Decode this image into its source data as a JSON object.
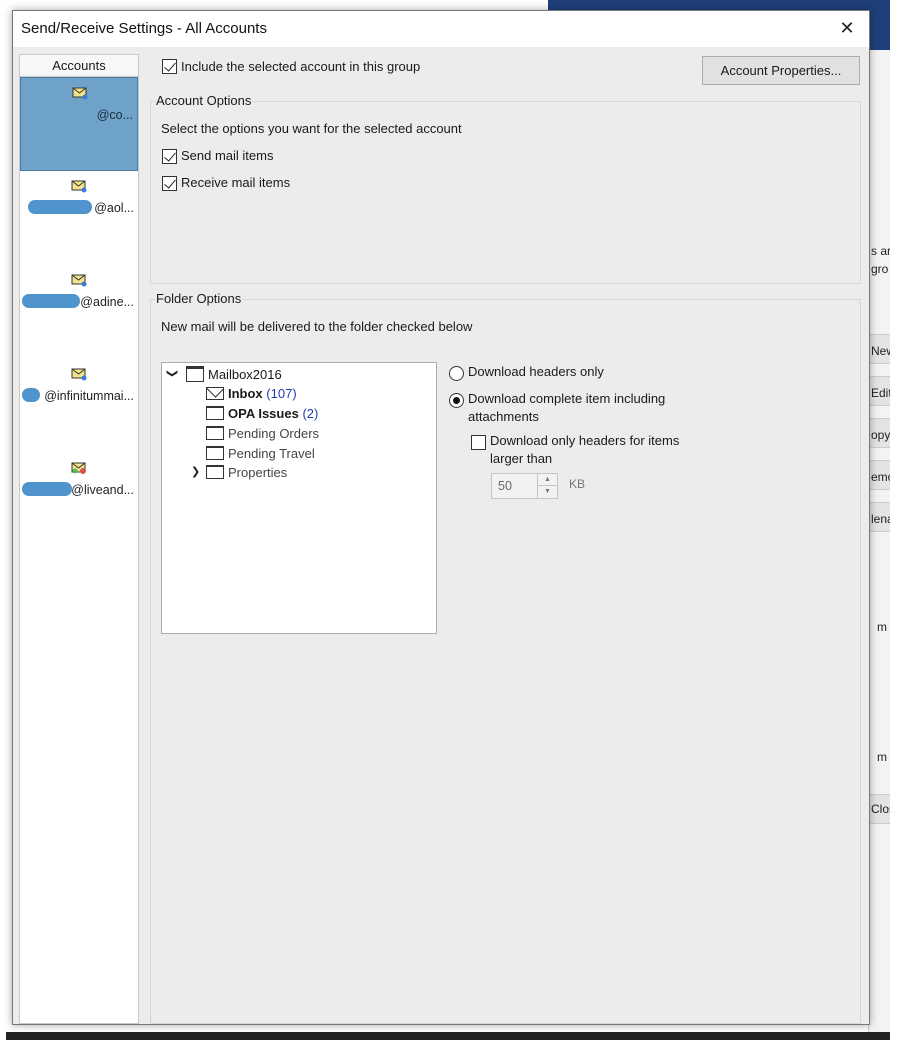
{
  "background": {
    "fragments": [
      "s ar",
      "gro",
      "New",
      "Edit.",
      "opy",
      "emo",
      "lenar",
      "m",
      "m",
      "Clos"
    ]
  },
  "dialog": {
    "title": "Send/Receive Settings - All Accounts",
    "close_label": "✕"
  },
  "accounts": {
    "header": "Accounts",
    "items": [
      {
        "label": "@co...",
        "selected": true
      },
      {
        "label": "@aol..."
      },
      {
        "label": "@adine..."
      },
      {
        "label": "@infinitummai..."
      },
      {
        "label": "@liveand..."
      }
    ]
  },
  "include": {
    "label": "Include the selected account in this group",
    "checked": true
  },
  "account_properties_button": "Account Properties...",
  "account_options": {
    "title": "Account Options",
    "description": "Select the options you want for the selected account",
    "send_label": "Send mail items",
    "receive_label": "Receive mail items"
  },
  "folder_options": {
    "title": "Folder Options",
    "description": "New mail will be delivered to the folder checked below",
    "tree": {
      "root": "Mailbox2016",
      "inbox": {
        "name": "Inbox",
        "count": "(107)"
      },
      "opa": {
        "name": "OPA Issues",
        "count": "(2)"
      },
      "pending_orders": "Pending Orders",
      "pending_travel": "Pending Travel",
      "properties": "Properties"
    },
    "download_headers_only": "Download headers only",
    "download_complete_line1": "Download complete item including",
    "download_complete_line2": "attachments",
    "download_only_headers_line1": "Download only headers for items",
    "download_only_headers_line2": "larger than",
    "size_value": "50",
    "size_unit": "KB"
  }
}
